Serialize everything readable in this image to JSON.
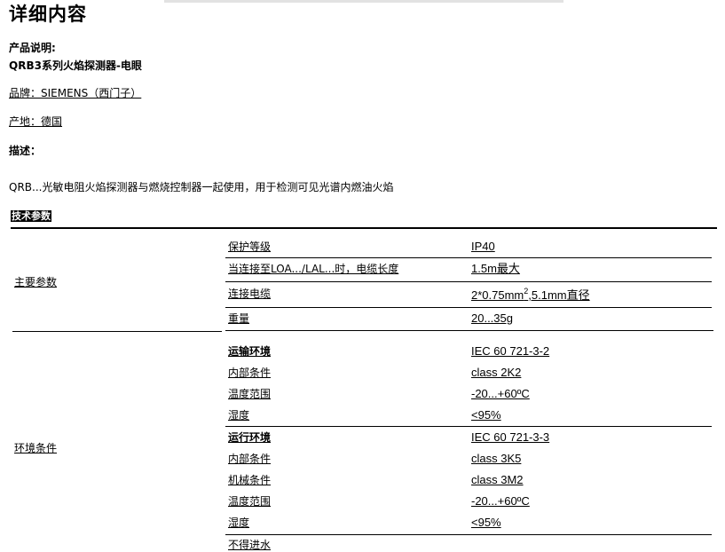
{
  "page": {
    "title": "详细内容",
    "desc_label": "产品说明:",
    "product_name": "QRB3系列火焰探测器-电眼",
    "brand": "品牌：SIEMENS（西门子）",
    "origin": "产地：德国",
    "describe_label": "描述：",
    "description": "QRB...光敏电阻火焰探测器与燃烧控制器一起使用，用于检测可见光谱内燃油火焰",
    "tech_label": "技术参数"
  },
  "specs": {
    "main": {
      "group": "主要参数",
      "rows": [
        {
          "label": "保护等级",
          "value": "IP40"
        },
        {
          "label": "当连接至LOA.../LAL...时，电缆长度",
          "value": "1.5m最大"
        },
        {
          "label": "连接电缆",
          "value_pre": "2*0.75mm",
          "value_sup": "2",
          "value_post": ",5.1mm直径"
        },
        {
          "label": "重量",
          "value": "20...35g"
        }
      ]
    },
    "env": {
      "group": "环境条件",
      "rows": [
        {
          "label": "运输环境",
          "value": "IEC 60 721-3-2"
        },
        {
          "label": "内部条件",
          "value": "class 2K2"
        },
        {
          "label": "温度范围",
          "value": "-20...+60ºC"
        },
        {
          "label": "湿度",
          "value": "<95%"
        },
        {
          "label": "运行环境",
          "value": "IEC 60 721-3-3"
        },
        {
          "label": "内部条件",
          "value": "class 3K5"
        },
        {
          "label": "机械条件",
          "value": "class 3M2"
        },
        {
          "label": "温度范围",
          "value": "-20...+60ºC"
        },
        {
          "label": "湿度",
          "value": "<95%"
        },
        {
          "label": "不得进水",
          "value": ""
        }
      ]
    }
  }
}
